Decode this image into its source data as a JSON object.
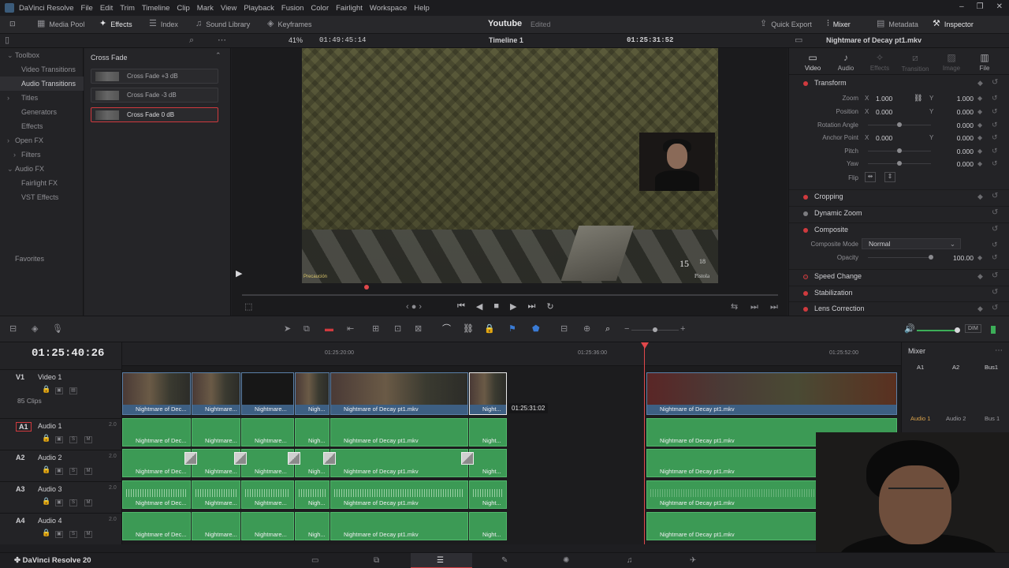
{
  "app": {
    "title": "DaVinci Resolve",
    "menu": [
      "File",
      "Edit",
      "Trim",
      "Timeline",
      "Clip",
      "Mark",
      "View",
      "Playback",
      "Fusion",
      "Color",
      "Fairlight",
      "Workspace",
      "Help"
    ],
    "footer_brand": "DaVinci Resolve 20"
  },
  "toolbar": {
    "media_pool": "Media Pool",
    "effects": "Effects",
    "index": "Index",
    "sound_library": "Sound Library",
    "keyframes": "Keyframes",
    "project": "Youtube",
    "project_status": "Edited",
    "quick_export": "Quick Export",
    "mixer": "Mixer",
    "metadata": "Metadata",
    "inspector": "Inspector"
  },
  "viewer_bar": {
    "zoom": "41%",
    "source_tc": "01:49:45:14",
    "timeline": "Timeline 1",
    "record_tc": "01:25:31:52",
    "clip_name": "Nightmare of Decay pt1.mkv"
  },
  "toolbox": {
    "items": [
      {
        "label": "Toolbox",
        "arrow": "⌄"
      },
      {
        "label": "Video Transitions",
        "arrow": ""
      },
      {
        "label": "Audio Transitions",
        "arrow": ""
      },
      {
        "label": "Titles",
        "arrow": "›"
      },
      {
        "label": "Generators",
        "arrow": ""
      },
      {
        "label": "Effects",
        "arrow": ""
      },
      {
        "label": "Open FX",
        "arrow": "›"
      },
      {
        "label": "Filters",
        "arrow": "›"
      },
      {
        "label": "Audio FX",
        "arrow": "⌄"
      },
      {
        "label": "Fairlight FX",
        "arrow": ""
      },
      {
        "label": "VST Effects",
        "arrow": ""
      }
    ],
    "favorites": "Favorites"
  },
  "effects_list": {
    "header": "Cross Fade",
    "items": [
      "Cross Fade +3 dB",
      "Cross Fade -3 dB",
      "Cross Fade 0 dB"
    ]
  },
  "frame": {
    "ammo": "15",
    "ammo_reserve": "18",
    "weapon": "Pistola",
    "hud": "Precaución"
  },
  "inspector": {
    "tabs": [
      "Video",
      "Audio",
      "Effects",
      "Transition",
      "Image",
      "File"
    ],
    "sections": {
      "transform": "Transform",
      "cropping": "Cropping",
      "dynamic_zoom": "Dynamic Zoom",
      "composite": "Composite",
      "speed_change": "Speed Change",
      "stabilization": "Stabilization",
      "lens_correction": "Lens Correction"
    },
    "params": {
      "zoom": {
        "label": "Zoom",
        "x": "1.000",
        "y": "1.000"
      },
      "position": {
        "label": "Position",
        "x": "0.000",
        "y": "0.000"
      },
      "rotation": {
        "label": "Rotation Angle",
        "value": "0.000",
        "level": 0.5
      },
      "anchor": {
        "label": "Anchor Point",
        "x": "0.000",
        "y": "0.000"
      },
      "pitch": {
        "label": "Pitch",
        "value": "0.000",
        "level": 0.5
      },
      "yaw": {
        "label": "Yaw",
        "value": "0.000",
        "level": 0.5
      },
      "flip": {
        "label": "Flip"
      },
      "composite_mode": {
        "label": "Composite Mode",
        "value": "Normal"
      },
      "opacity": {
        "label": "Opacity",
        "value": "100.00",
        "level": 1.0
      }
    }
  },
  "timeline": {
    "timecode": "01:25:40:26",
    "ruler": [
      "01:25:20:00",
      "01:25:36:00",
      "01:25:52:00"
    ],
    "tooltip_tc": "01:25:31:02",
    "tracks": [
      {
        "id": "V1",
        "name": "Video 1",
        "level": "",
        "extra": "85 Clips"
      },
      {
        "id": "A1",
        "name": "Audio 1",
        "level": "2.0",
        "extra": ""
      },
      {
        "id": "A2",
        "name": "Audio 2",
        "level": "2.0",
        "extra": ""
      },
      {
        "id": "A3",
        "name": "Audio 3",
        "level": "2.0",
        "extra": ""
      },
      {
        "id": "A4",
        "name": "Audio 4",
        "level": "2.0",
        "extra": ""
      }
    ],
    "clip_labels": [
      "Nightmare of Dec...",
      "Nightmare...",
      "Nightmare...",
      "Nigh...",
      "Nightmare of Decay pt1.mkv",
      "Night...",
      "Nightmare of Decay pt1.mkv"
    ]
  },
  "mixer": {
    "title": "Mixer",
    "channels": [
      "A1",
      "A2",
      "Bus1"
    ],
    "channel_names": [
      "Audio 1",
      "Audio 2",
      "Bus 1"
    ],
    "dim": "DIM"
  },
  "colors": {
    "accent": "#d03a3e",
    "video_clip": "#3d5f83",
    "audio_clip": "#3c9a55"
  }
}
